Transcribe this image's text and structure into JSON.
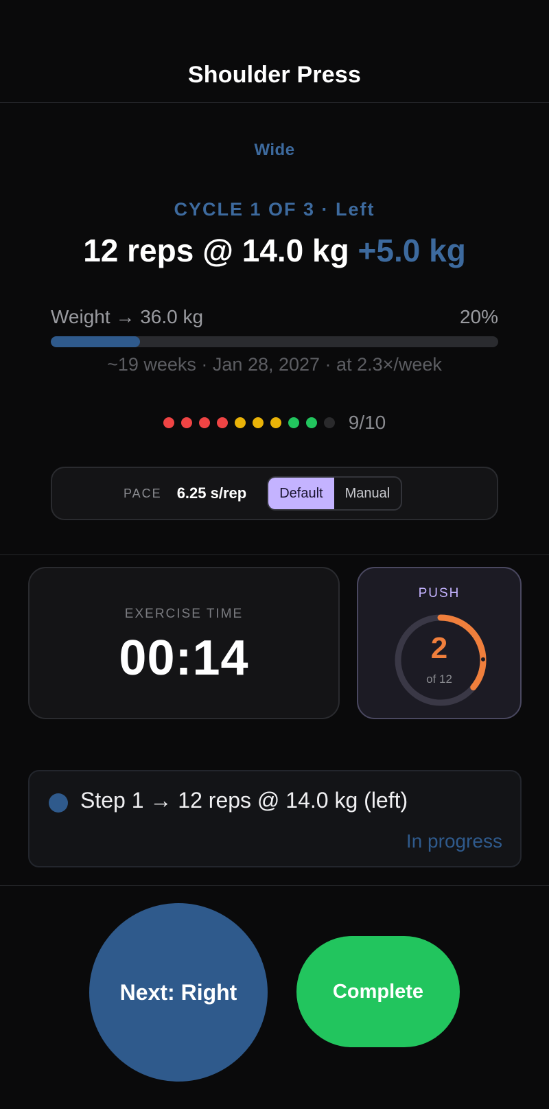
{
  "header": {
    "title": "Shoulder Press"
  },
  "exercise": {
    "grip": "Wide",
    "cycle": "CYCLE 1 OF 3 · Left",
    "target": "12 reps @ 14.0 kg",
    "delta": "+5.0 kg"
  },
  "goal": {
    "label": "Weight → 36.0 kg",
    "percent_text": "20%",
    "progress": 0.2,
    "eta": "~19 weeks · Jan 28, 2027 · at 2.3×/week"
  },
  "rpe": {
    "text": "9/10",
    "filled": 9,
    "total": 10,
    "colors": [
      "#ef4444",
      "#ef4444",
      "#ef4444",
      "#ef4444",
      "#eab308",
      "#eab308",
      "#eab308",
      "#22c55e",
      "#22c55e",
      "#2a2a2c"
    ]
  },
  "pace": {
    "label": "PACE",
    "value": "6.25 s/rep",
    "options": [
      "Default",
      "Manual"
    ],
    "selected": "Default"
  },
  "timer": {
    "label": "EXERCISE TIME",
    "value": "00:14"
  },
  "push": {
    "label": "PUSH",
    "count": "2",
    "of": "of 12",
    "fraction": 0.2,
    "ring_color": "#f07f3c",
    "track_color": "#3a3846"
  },
  "step": {
    "text": "Step 1 → 12 reps @ 14.0 kg (left)",
    "status": "In progress"
  },
  "actions": {
    "next_label": "Next: Right",
    "complete_label": "Complete"
  },
  "colors": {
    "background": "#0a0a0b",
    "accent_blue": "#2f5a8c",
    "accent_purple": "#c4b3ff",
    "accent_orange": "#f07f3c",
    "accent_green": "#22c55e"
  }
}
